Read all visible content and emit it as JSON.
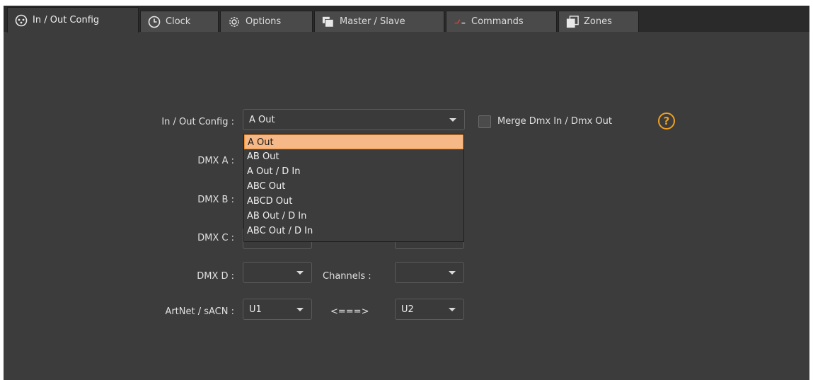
{
  "tabs": [
    {
      "label": "In / Out Config",
      "icon": "dmx-connector-icon"
    },
    {
      "label": "Clock",
      "icon": "clock-icon"
    },
    {
      "label": "Options",
      "icon": "gear-icon"
    },
    {
      "label": "Master / Slave",
      "icon": "windows-stack-icon"
    },
    {
      "label": "Commands",
      "icon": "commands-icon"
    },
    {
      "label": "Zones",
      "icon": "zones-icon"
    }
  ],
  "config": {
    "inout_label": "In / Out Config :",
    "inout_value": "A Out",
    "merge_label": "Merge Dmx In / Dmx Out",
    "merge_checked": false,
    "help_glyph": "?",
    "accent_color": "#f0a020"
  },
  "dropdown": {
    "options": [
      "A Out",
      "AB Out",
      "A Out / D In",
      "ABC Out",
      "ABCD Out",
      "AB Out / D In",
      "ABC Out / D In"
    ],
    "selected": "A Out"
  },
  "dmx": {
    "a_label": "DMX A :",
    "b_label": "DMX B :",
    "c_label": "DMX C :",
    "d_label": "DMX D :",
    "d_value": "",
    "channels_label": "Channels :",
    "channels_value": ""
  },
  "artnet": {
    "label": "ArtNet / sACN :",
    "from_value": "U1",
    "arrow_text": "<===>",
    "to_value": "U2"
  }
}
